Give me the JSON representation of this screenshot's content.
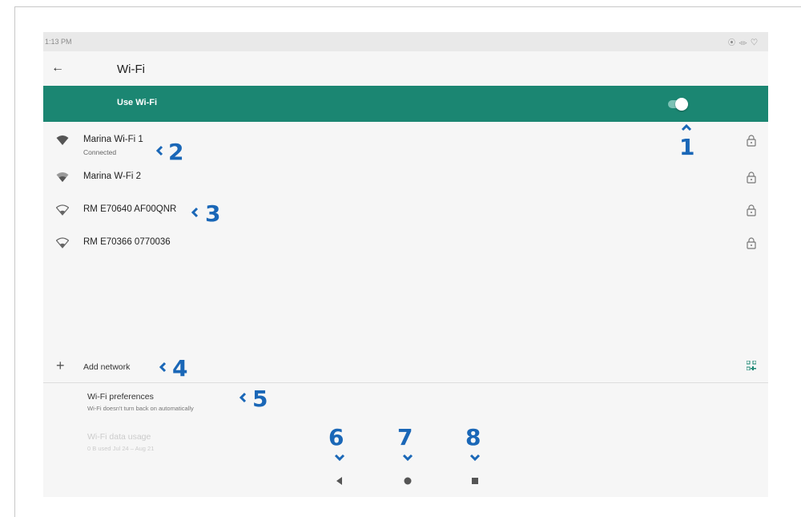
{
  "status_bar": {
    "time": "1:13 PM",
    "icons": "⦿ ◃▹ ♡"
  },
  "app_bar": {
    "back_icon": "arrow-left-icon",
    "title": "Wi-Fi"
  },
  "use_wifi": {
    "label": "Use Wi-Fi",
    "enabled": true
  },
  "networks": [
    {
      "name": "Marina Wi-Fi 1",
      "status": "Connected",
      "icon": "wifi-signal-icon",
      "secured": true
    },
    {
      "name": "Marina W-Fi 2",
      "status": "",
      "icon": "wifi-signal-icon",
      "secured": true
    },
    {
      "name": "RM E70640 AF00QNR",
      "status": "",
      "icon": "wifi-signal-icon",
      "secured": true
    },
    {
      "name": "RM E70366 0770036",
      "status": "",
      "icon": "wifi-signal-icon",
      "secured": true
    }
  ],
  "add_network": {
    "label": "Add network",
    "icon": "plus-icon",
    "qr_icon": "qr-code-icon"
  },
  "preferences": {
    "label": "Wi-Fi preferences",
    "sub": "Wi-Fi doesn't turn back on automatically"
  },
  "data_usage": {
    "label": "Wi-Fi data usage",
    "sub": "0 B used Jul 24 – Aug 21"
  },
  "nav_bar": {
    "back": "triangle-back-icon",
    "home": "circle-home-icon",
    "recents": "square-recents-icon"
  },
  "callouts": [
    "1",
    "2",
    "3",
    "4",
    "5",
    "6",
    "7",
    "8"
  ],
  "colors": {
    "accent": "#1b8672",
    "callout": "#1a67b7"
  }
}
